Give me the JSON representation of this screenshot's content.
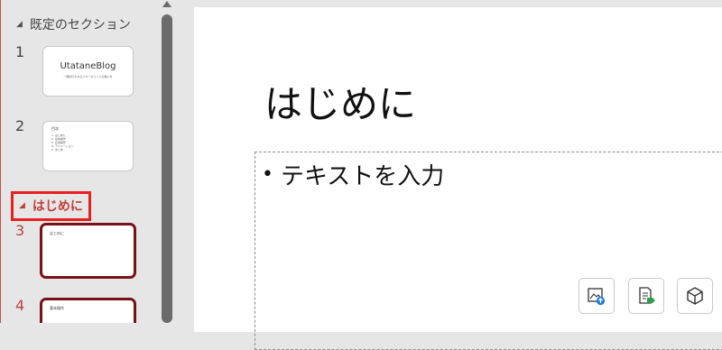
{
  "sidebar": {
    "sections": [
      {
        "label": "既定のセクション"
      },
      {
        "label": "はじめに"
      }
    ],
    "slides": [
      {
        "number": "1",
        "title": "UtataneBlog",
        "subtitle": "一時間でわかるパワーポイントの使い方"
      },
      {
        "number": "2",
        "title": "目次",
        "items": [
          "はじめに",
          "基本操作",
          "応用操作",
          "アニメーション",
          "まとめ"
        ]
      },
      {
        "number": "3",
        "title": "はじめに"
      },
      {
        "number": "4",
        "title": "基本操作"
      }
    ]
  },
  "slide": {
    "title": "はじめに",
    "body_placeholder": "テキストを入力",
    "insert_icons": [
      "insert-picture-icon",
      "insert-document-icon",
      "insert-3d-model-icon"
    ]
  },
  "colors": {
    "section_highlight": "#e8201f",
    "selected_border": "#7a1116",
    "active_text": "#c0413a"
  }
}
